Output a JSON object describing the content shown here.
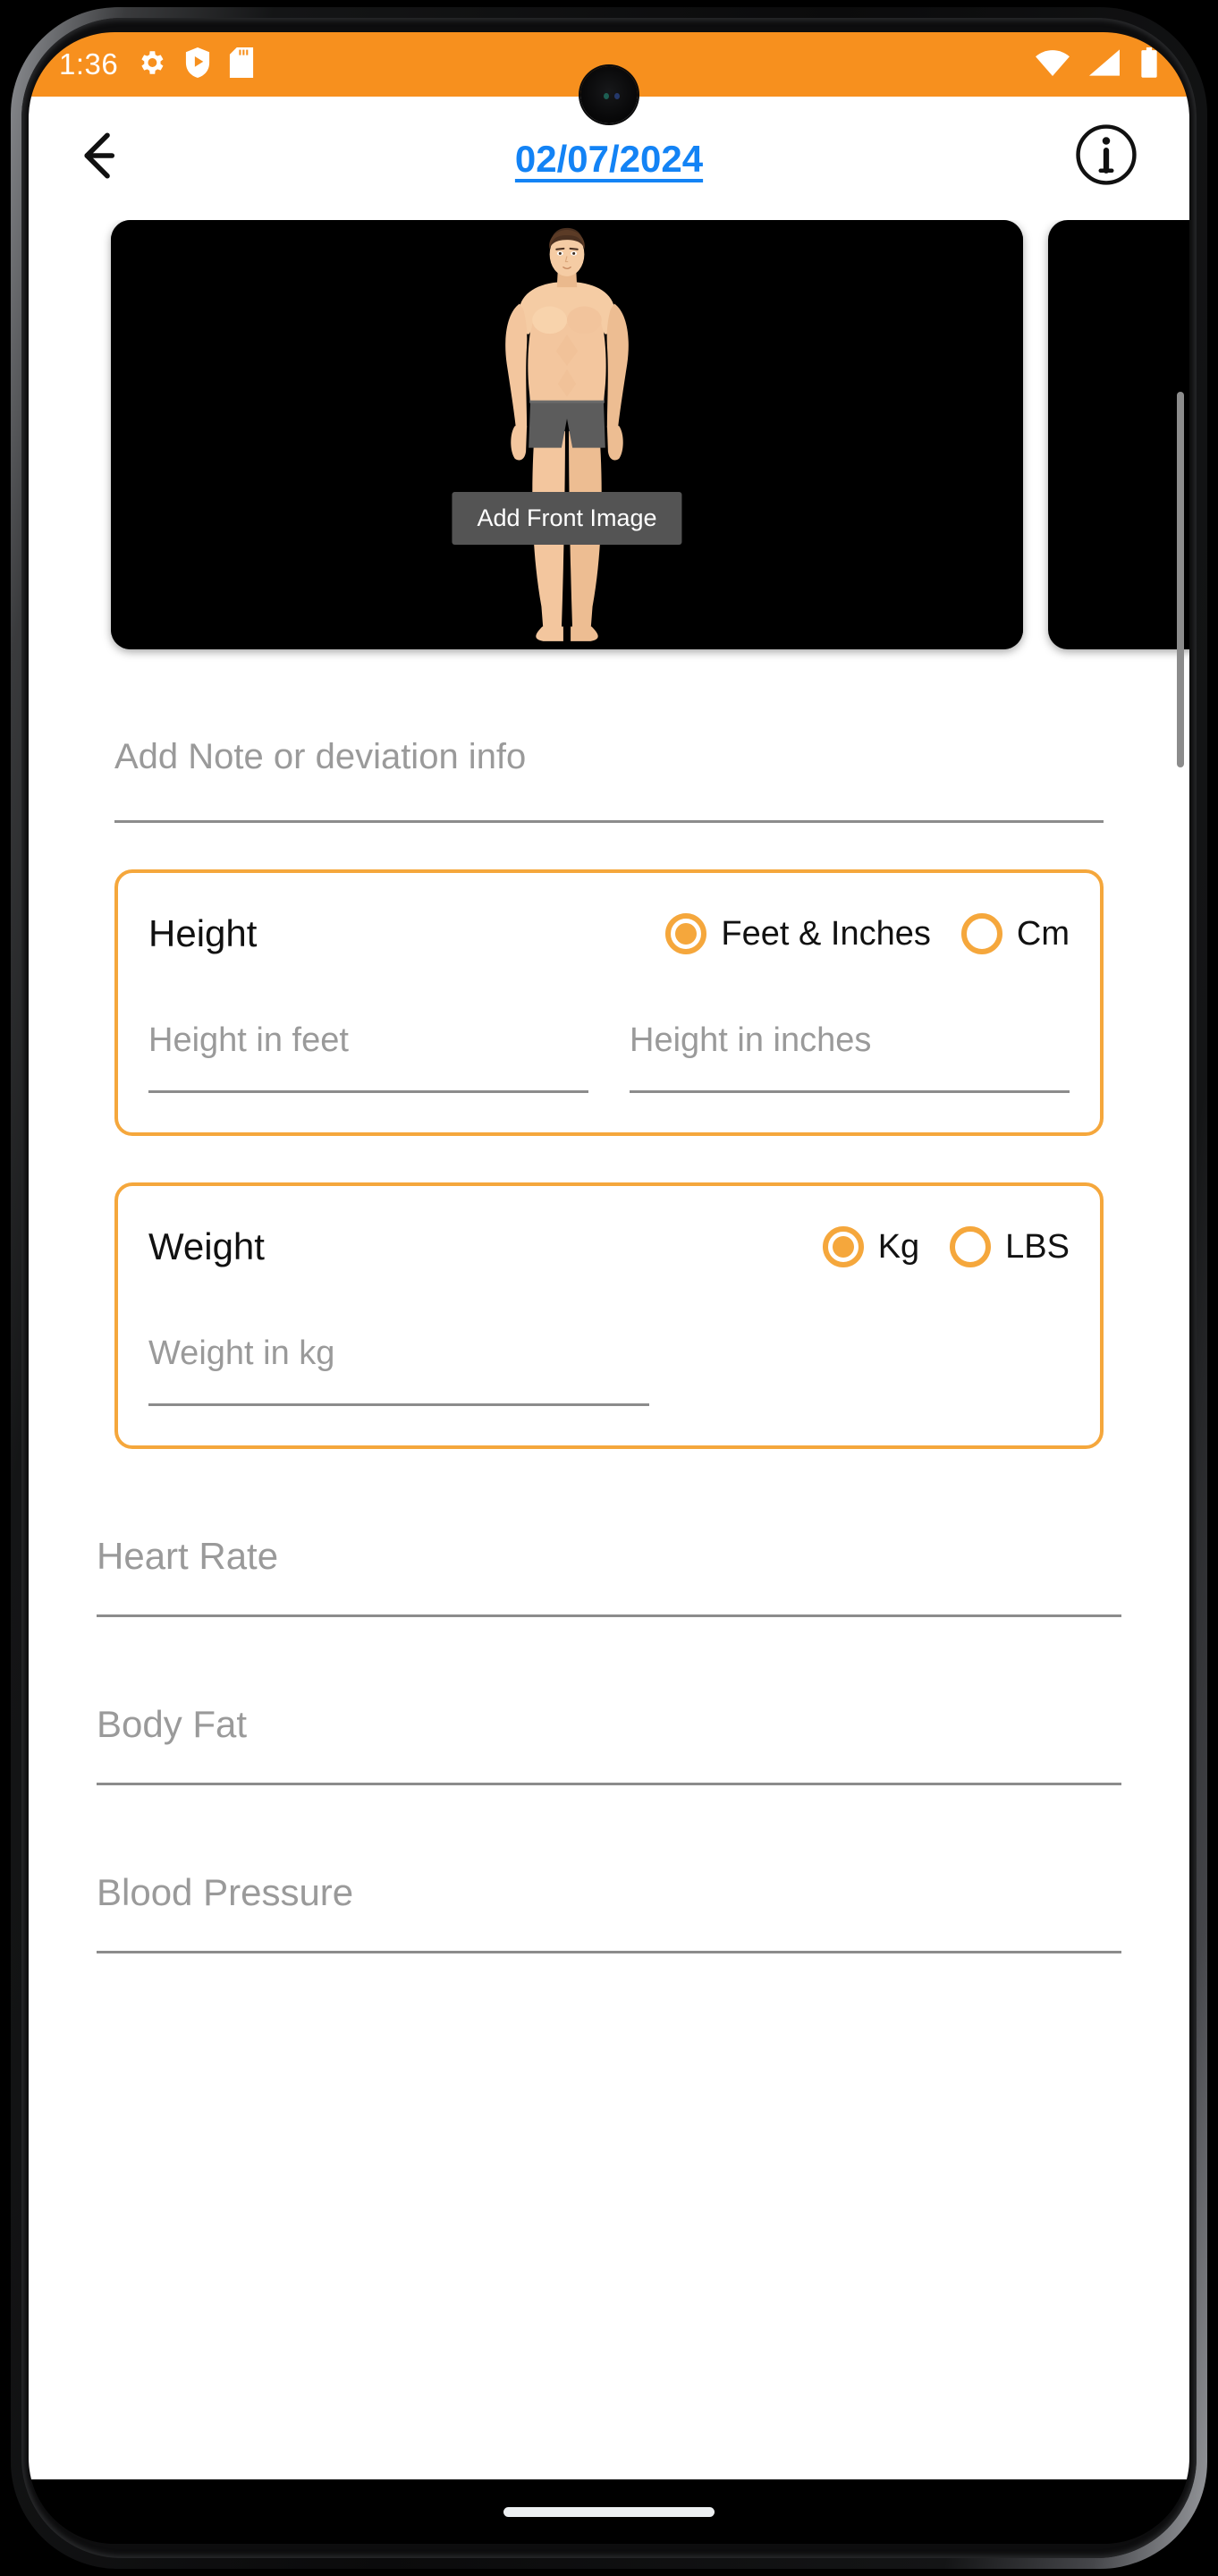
{
  "status_bar": {
    "time": "1:36",
    "left_icons": [
      "gear-icon",
      "shield-play-icon",
      "sd-card-icon"
    ],
    "right_icons": [
      "wifi-icon",
      "cell-signal-icon",
      "battery-icon"
    ],
    "background_color": "#F7901E"
  },
  "app_bar": {
    "back_icon": "arrow-left-icon",
    "date": "02/07/2024",
    "date_color": "#1383F5",
    "info_icon": "info-circle-icon"
  },
  "carousel": {
    "cards": [
      {
        "label": "Add Front Image",
        "badge_color": "#545454",
        "background": "#000000"
      },
      {
        "label": "",
        "badge_color": "#545454",
        "background": "#000000"
      }
    ]
  },
  "note": {
    "placeholder": "Add Note or deviation info",
    "value": ""
  },
  "height_card": {
    "label": "Height",
    "accent_color": "#F5A73C",
    "options": [
      {
        "label": "Feet & Inches",
        "selected": true
      },
      {
        "label": "Cm",
        "selected": false
      }
    ],
    "inputs": [
      {
        "placeholder": "Height in feet",
        "value": ""
      },
      {
        "placeholder": "Height in inches",
        "value": ""
      }
    ]
  },
  "weight_card": {
    "label": "Weight",
    "accent_color": "#F5A73C",
    "options": [
      {
        "label": "Kg",
        "selected": true
      },
      {
        "label": "LBS",
        "selected": false
      }
    ],
    "inputs": [
      {
        "placeholder": "Weight in kg",
        "value": ""
      }
    ]
  },
  "fields": [
    {
      "placeholder": "Heart Rate",
      "value": ""
    },
    {
      "placeholder": "Body Fat",
      "value": ""
    },
    {
      "placeholder": "Blood Pressure",
      "value": ""
    }
  ],
  "nav_bar": {
    "gesture_pill": "home-gesture-pill"
  }
}
